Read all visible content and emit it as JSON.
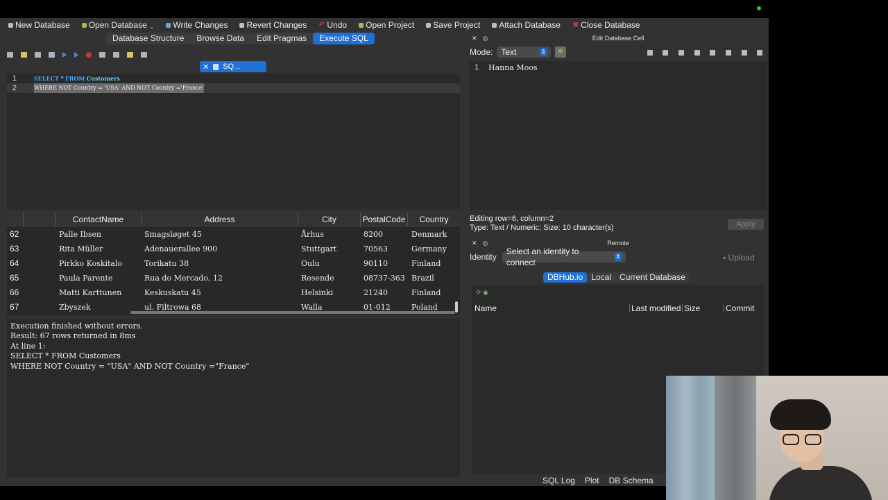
{
  "toolbar": {
    "new_db": "New Database",
    "open_db": "Open Database",
    "write": "Write Changes",
    "revert": "Revert Changes",
    "undo": "Undo",
    "open_project": "Open Project",
    "save_project": "Save Project",
    "attach_db": "Attach Database",
    "close_db": "Close Database"
  },
  "tabs": [
    "Database Structure",
    "Browse Data",
    "Edit Pragmas",
    "Execute SQL"
  ],
  "sql_tab": {
    "label": "SQ..."
  },
  "editor": {
    "line1_no": "1",
    "line2_no": "2",
    "kw_select": "SELECT",
    "star": " * ",
    "kw_from": "FROM",
    "table": "Customers",
    "line2": "WHERE NOT Country = 'USA' AND NOT Country ='France'"
  },
  "grid": {
    "headers": [
      "ContactName",
      "Address",
      "City",
      "PostalCode",
      "Country"
    ],
    "rows": [
      [
        "62",
        "Palle Ibsen",
        "Smagsløget 45",
        "Århus",
        "8200",
        "Denmark"
      ],
      [
        "63",
        "Rita Müller",
        "Adenauerallee 900",
        "Stuttgart",
        "70563",
        "Germany"
      ],
      [
        "64",
        "Pirkko Koskitalo",
        "Torikatu 38",
        "Oulu",
        "90110",
        "Finland"
      ],
      [
        "65",
        "Paula Parente",
        "Rua do Mercado, 12",
        "Resende",
        "08737-363",
        "Brazil"
      ],
      [
        "66",
        "Matti Karttunen",
        "Keskuskatu 45",
        "Helsinki",
        "21240",
        "Finland"
      ],
      [
        "67",
        "Zbyszek",
        "ul. Filtrowa 68",
        "Walla",
        "01-012",
        "Poland"
      ]
    ]
  },
  "messages": {
    "l1": "Execution finished without errors.",
    "l2": "Result: 67 rows returned in 8ms",
    "l3": "At line 1:",
    "l4": "SELECT * FROM Customers",
    "l5": "WHERE NOT Country = \"USA\" AND NOT Country =\"France\""
  },
  "edit_cell": {
    "title": "Edit Database Cell",
    "mode_label": "Mode:",
    "mode_value": "Text",
    "line_no": "1",
    "value": "Hanna Moos",
    "info1": "Editing row=6, column=2",
    "info2": "Type: Text / Numeric; Size: 10 character(s)",
    "apply": "Apply"
  },
  "remote": {
    "title": "Remote",
    "identity_label": "Identity",
    "identity_placeholder": "Select an identity to connect",
    "upload": "Upload",
    "tabs": [
      "DBHub.io",
      "Local",
      "Current Database"
    ],
    "columns": [
      "Name",
      "Last modified",
      "Size",
      "Commit"
    ]
  },
  "bottom_tabs": [
    "SQL Log",
    "Plot",
    "DB Schema"
  ],
  "colors": {
    "accent": "#1f6fd6",
    "keyword": "#4aa6ff",
    "table_name": "#5fd3ff",
    "status_dot": "#2ec24a"
  }
}
